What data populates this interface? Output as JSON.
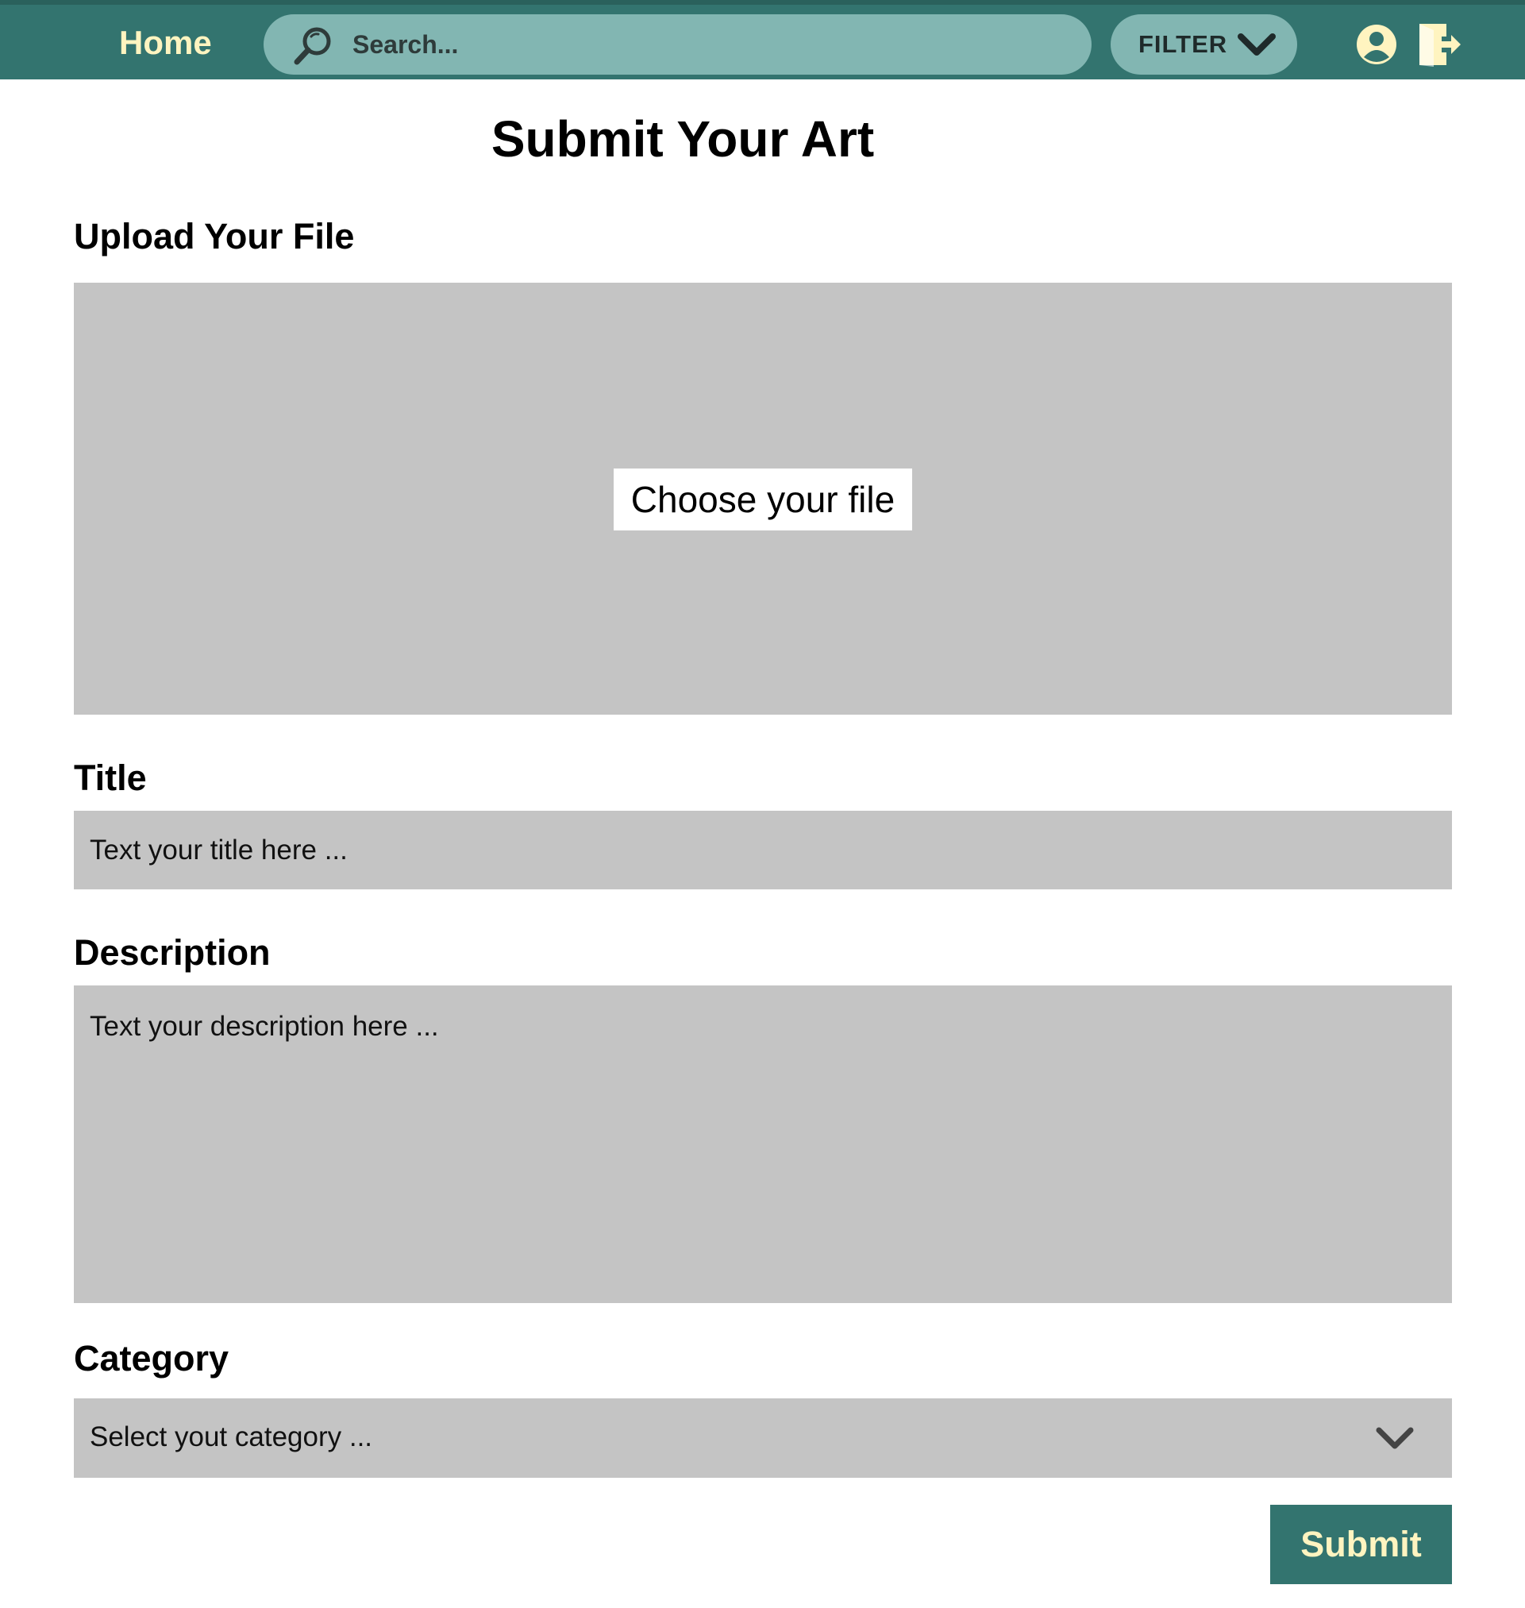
{
  "nav": {
    "home_label": "Home",
    "search_placeholder": "Search...",
    "filter_label": "FILTER",
    "icons": [
      "search-icon",
      "chevron-down-icon",
      "user-icon",
      "logout-icon"
    ]
  },
  "form": {
    "page_title": "Submit Your Art",
    "upload": {
      "label": "Upload Your File",
      "button_label": "Choose your file"
    },
    "title": {
      "label": "Title",
      "placeholder": "Text your title here ..."
    },
    "description": {
      "label": "Description",
      "placeholder": "Text your description here ..."
    },
    "category": {
      "label": "Category",
      "selected_text": "Select yout category ..."
    },
    "submit_label": "Submit"
  },
  "colors": {
    "nav_background": "#33746f",
    "pill_background": "#82b6b2",
    "accent_text": "#fff4c0",
    "field_background": "#c4c4c4"
  }
}
